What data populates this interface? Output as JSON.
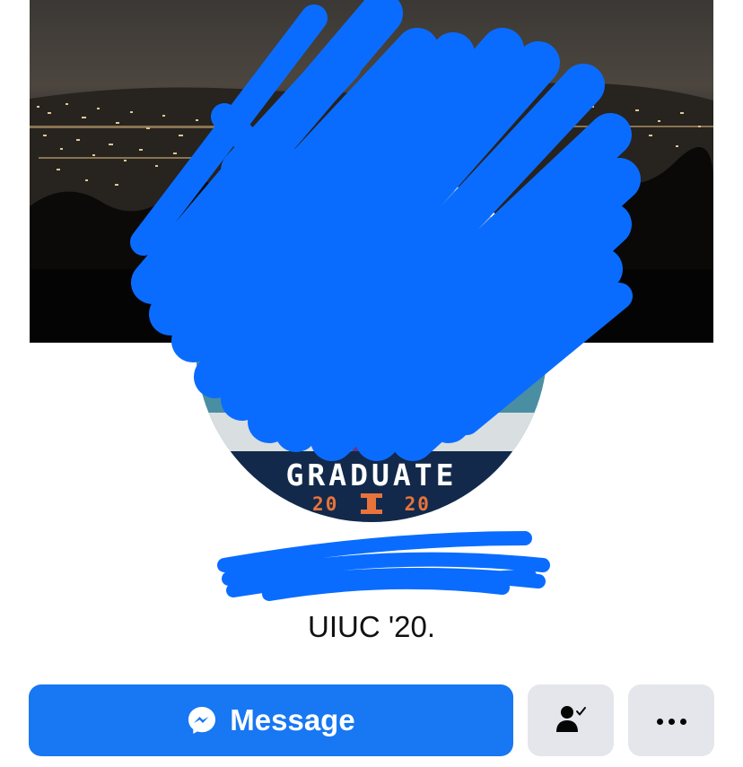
{
  "profile": {
    "frame_title": "GRADUATE",
    "frame_year_left": "20",
    "frame_year_right": "20",
    "bio": "UIUC '20."
  },
  "actions": {
    "message_label": "Message",
    "message_icon": "messenger-icon",
    "friends_icon": "friends-check-icon",
    "more_icon": "more-dots-icon"
  },
  "colors": {
    "accent": "#1877f2",
    "secondary_button": "#e4e6eb",
    "redaction": "#0a6cff",
    "frame_banner": "#13294b",
    "frame_accent": "#e8743b"
  }
}
